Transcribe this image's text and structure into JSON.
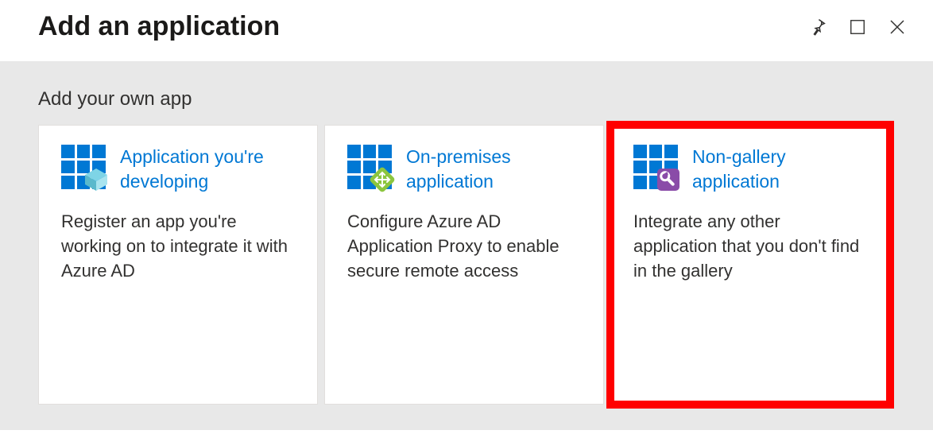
{
  "header": {
    "title": "Add an application"
  },
  "section": {
    "title": "Add your own app"
  },
  "cards": [
    {
      "title": "Application you're developing",
      "desc": "Register an app you're working on to integrate it with Azure AD",
      "icon": "app-developing-icon"
    },
    {
      "title": "On-premises application",
      "desc": "Configure Azure AD Application Proxy to enable secure remote access",
      "icon": "on-prem-app-icon"
    },
    {
      "title": "Non-gallery application",
      "desc": "Integrate any other application that you don't find in the gallery",
      "icon": "non-gallery-app-icon"
    }
  ],
  "colors": {
    "link": "#0078d4",
    "highlight": "#ff0000"
  }
}
